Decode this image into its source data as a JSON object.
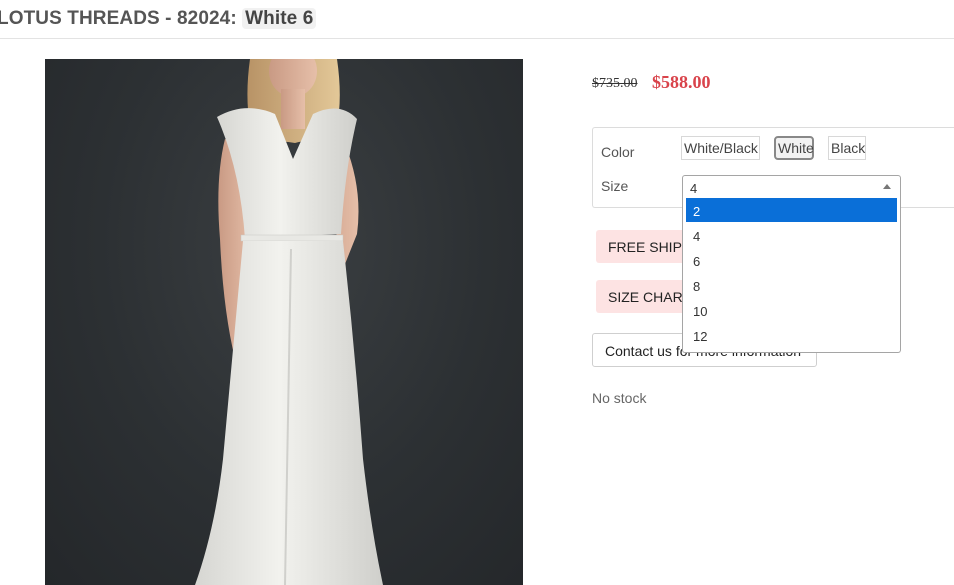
{
  "product": {
    "title": "LOTUS THREADS - 82024:",
    "variant": "White 6"
  },
  "photo": {
    "alt": "Model wearing white cap-sleeve V-neck sheath gown"
  },
  "price": {
    "original": "$735.00",
    "sale": "$588.00",
    "sale_color": "#d9434b"
  },
  "options": {
    "color_label": "Color",
    "colors": [
      "White/Black",
      "White",
      "Black"
    ],
    "selected_color": "White",
    "size_label": "Size",
    "size_value": "4",
    "size_options": [
      "2",
      "4",
      "6",
      "8",
      "10",
      "12"
    ],
    "highlighted_size": "2",
    "highlight_color": "#0a6fd8"
  },
  "info": {
    "shipping": "FREE SHIPPING",
    "size_chart": "SIZE CHART",
    "contact": "Contact us for more information",
    "stock": "No stock"
  }
}
